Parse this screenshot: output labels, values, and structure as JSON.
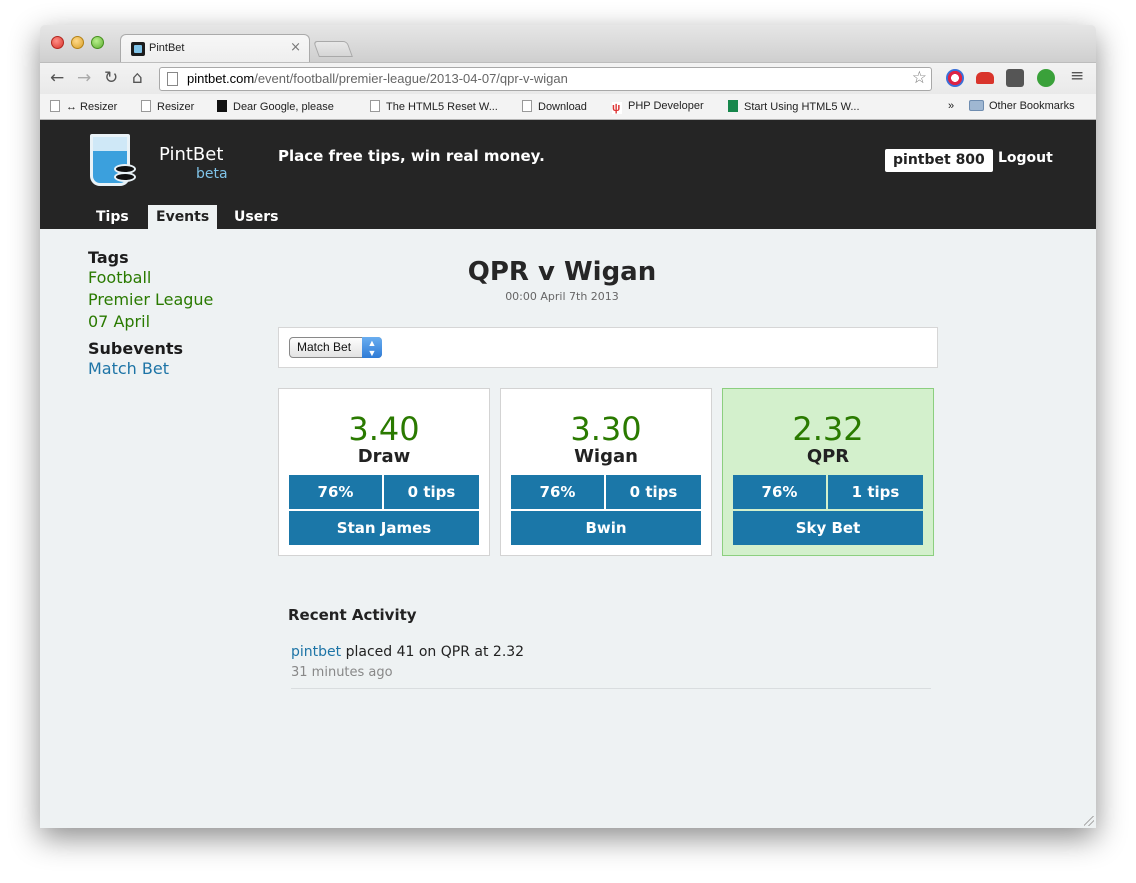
{
  "browser": {
    "tab_title": "PintBet",
    "tab_close": "×",
    "url_domain": "pintbet.com",
    "url_path": "/event/football/premier-league/2013-04-07/qpr-v-wigan",
    "bookmarks": [
      {
        "label": "↔ Resizer"
      },
      {
        "label": "Resizer"
      },
      {
        "label": "Dear Google, please"
      },
      {
        "label": "The HTML5 Reset W..."
      },
      {
        "label": "Download"
      },
      {
        "label": "PHP Developer"
      },
      {
        "label": "Start Using HTML5 W..."
      }
    ],
    "bookmarks_overflow": "»",
    "other_bookmarks": "Other Bookmarks"
  },
  "site": {
    "brand": "PintBet",
    "beta": "beta",
    "tagline": "Place free tips, win real money.",
    "balance": "pintbet 800",
    "logout": "Logout",
    "nav": [
      {
        "label": "Tips"
      },
      {
        "label": "Events"
      },
      {
        "label": "Users"
      }
    ]
  },
  "sidebar": {
    "tags_heading": "Tags",
    "tags": [
      "Football",
      "Premier League",
      "07 April"
    ],
    "subevents_heading": "Subevents",
    "subevents": [
      "Match Bet"
    ]
  },
  "event": {
    "title": "QPR v Wigan",
    "date": "00:00 April 7th 2013",
    "market_select": "Match Bet",
    "outcomes": [
      {
        "odds": "3.40",
        "name": "Draw",
        "percent": "76%",
        "tips": "0 tips",
        "bookmaker": "Stan James",
        "selected": false
      },
      {
        "odds": "3.30",
        "name": "Wigan",
        "percent": "76%",
        "tips": "0 tips",
        "bookmaker": "Bwin",
        "selected": false
      },
      {
        "odds": "2.32",
        "name": "QPR",
        "percent": "76%",
        "tips": "1 tips",
        "bookmaker": "Sky Bet",
        "selected": true
      }
    ]
  },
  "activity": {
    "heading": "Recent Activity",
    "items": [
      {
        "user": "pintbet",
        "text": " placed 41 on QPR at 2.32",
        "time": "31 minutes ago"
      }
    ]
  },
  "colors": {
    "header_bg": "#252525",
    "accent_blue": "#1b77a8",
    "odds_green": "#2a7a00",
    "highlight_bg": "#d3f0cc"
  }
}
